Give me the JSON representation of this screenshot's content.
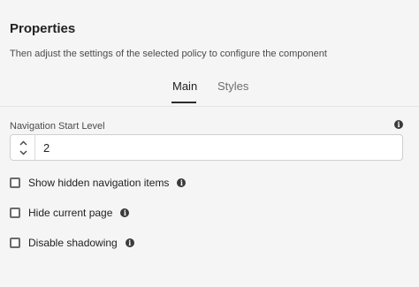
{
  "panel": {
    "title": "Properties",
    "subtitle": "Then adjust the settings of the selected policy to configure the component"
  },
  "tabs": [
    {
      "label": "Main",
      "selected": true
    },
    {
      "label": "Styles",
      "selected": false
    }
  ],
  "navigation_start_level": {
    "label": "Navigation Start Level",
    "value": "2"
  },
  "options": [
    {
      "label": "Show hidden navigation items",
      "checked": false
    },
    {
      "label": "Hide current page",
      "checked": false
    },
    {
      "label": "Disable shadowing",
      "checked": false
    }
  ],
  "icons": {
    "info": "info-icon",
    "stepper_up": "chevron-up-icon",
    "stepper_down": "chevron-down-icon"
  },
  "colors": {
    "background": "#f5f5f5",
    "tab_indicator": "#2c2c2c",
    "text": "#222222"
  }
}
